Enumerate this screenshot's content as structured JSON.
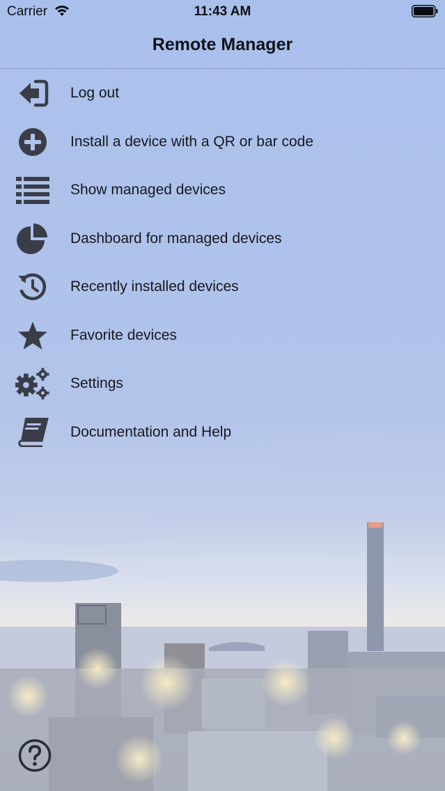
{
  "status_bar": {
    "carrier": "Carrier",
    "time": "11:43 AM",
    "wifi_icon": "wifi-icon",
    "battery_icon": "battery-icon"
  },
  "nav": {
    "title": "Remote Manager"
  },
  "menu": {
    "items": [
      {
        "label": "Log out",
        "icon": "logout-icon"
      },
      {
        "label": "Install a device with a QR or bar code",
        "icon": "plus-circle-icon"
      },
      {
        "label": "Show managed devices",
        "icon": "list-icon"
      },
      {
        "label": "Dashboard for managed devices",
        "icon": "pie-chart-icon"
      },
      {
        "label": "Recently installed devices",
        "icon": "history-icon"
      },
      {
        "label": "Favorite devices",
        "icon": "star-icon"
      },
      {
        "label": "Settings",
        "icon": "gears-icon"
      },
      {
        "label": "Documentation and Help",
        "icon": "book-icon"
      }
    ]
  },
  "help": {
    "icon": "help-icon"
  },
  "colors": {
    "background_top": "#aec4ec",
    "icon": "#3a3d47",
    "text": "#16181f"
  }
}
